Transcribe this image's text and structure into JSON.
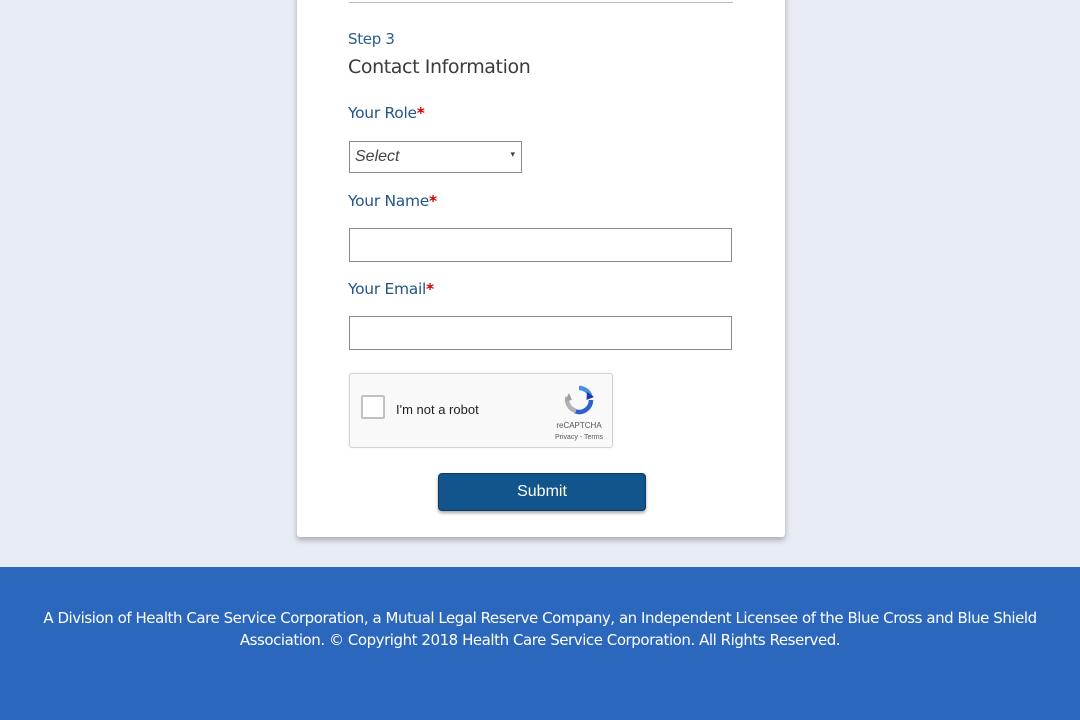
{
  "form": {
    "step_label": "Step 3",
    "section_title": "Contact Information",
    "role": {
      "label": "Your Role",
      "required_mark": "*",
      "selected": "Select",
      "arrow": "▾"
    },
    "name": {
      "label": "Your Name",
      "required_mark": "*",
      "value": ""
    },
    "email": {
      "label": "Your Email",
      "required_mark": "*",
      "value": ""
    },
    "recaptcha": {
      "label": "I'm not a robot",
      "brand": "reCAPTCHA",
      "links": "Privacy - Terms",
      "icon": "recaptcha-logo-icon",
      "checked": false
    },
    "submit_label": "Submit"
  },
  "footer": {
    "text": "A Division of Health Care Service Corporation, a Mutual Legal Reserve Company, an Independent Licensee of the Blue Cross and Blue Shield Association. © Copyright 2018 Health Care Service Corporation. All Rights Reserved."
  },
  "colors": {
    "page_background": "#e7ebf3",
    "footer_background": "#2b67bd",
    "label_blue": "#245584",
    "button_blue": "#12548c",
    "required_red": "#cc0000"
  }
}
